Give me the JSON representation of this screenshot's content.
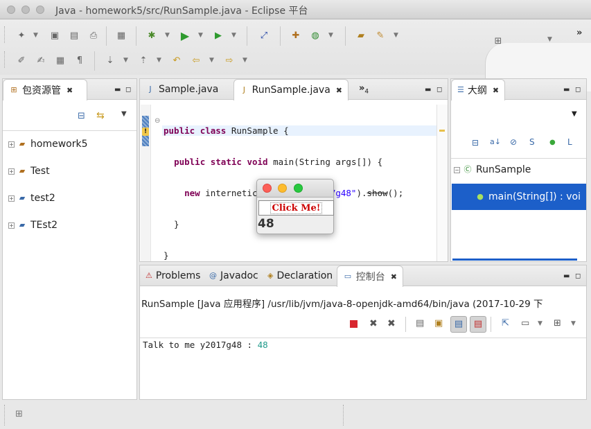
{
  "window": {
    "title": "Java - homework5/src/RunSample.java - Eclipse 平台"
  },
  "package_explorer": {
    "tab_label": "包资源管",
    "projects": [
      {
        "name": "homework5"
      },
      {
        "name": "Test"
      },
      {
        "name": "test2"
      },
      {
        "name": "TEst2"
      }
    ]
  },
  "editor": {
    "tabs": [
      {
        "label": "Sample.java"
      },
      {
        "label": "RunSample.java"
      }
    ],
    "overflow_label": "»",
    "overflow_count": "4",
    "code_lines": [
      "public class RunSample {",
      "  public static void main(String args[]) {",
      "    new internetics.Sample(\"y2017g48\").show();",
      "  }",
      "}"
    ]
  },
  "swing_window": {
    "button_label": "Click Me!",
    "value": "48"
  },
  "outline": {
    "tab_label": "大纲",
    "class_name": "RunSample",
    "method": "main(String[]) : voi"
  },
  "bottom_panel": {
    "tabs": [
      {
        "label": "Problems"
      },
      {
        "label": "Javadoc"
      },
      {
        "label": "Declaration"
      },
      {
        "label": "控制台"
      }
    ],
    "console_header": "RunSample [Java 应用程序] /usr/lib/jvm/java-8-openjdk-amd64/bin/java (2017-10-29 下",
    "console_output_prefix": "Talk to me y2017g48 : ",
    "console_output_value": "48"
  },
  "colors": {
    "selection_blue": "#1c5fc9",
    "keyword": "#7f0055",
    "string": "#2a00ff",
    "console_value": "#1f9a8a",
    "button_text": "#cc0000"
  }
}
